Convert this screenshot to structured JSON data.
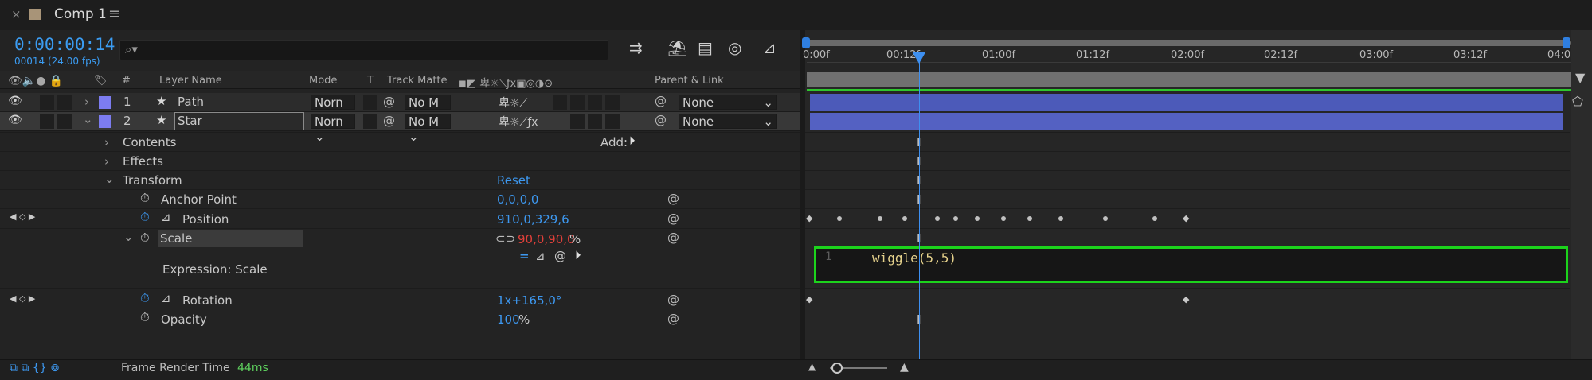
{
  "tab": {
    "close": "×",
    "title": "Comp 1",
    "menu": "≡"
  },
  "timecode": "0:00:00:14",
  "frame_fps": "00014 (24.00 fps)",
  "search": {
    "icon": "⌕▾",
    "placeholder": ""
  },
  "toolbar_icons": [
    "composition-mini-flowchart-icon",
    "draft-3d-icon",
    "frame-blending-icon",
    "motion-blur-icon",
    "graph-editor-icon"
  ],
  "columns": {
    "hash": "#",
    "layer_name": "Layer Name",
    "mode": "Mode",
    "t": "T",
    "track_matte": "Track Matte",
    "parent": "Parent & Link"
  },
  "layers": [
    {
      "num": "1",
      "star": "★",
      "name": "Path",
      "mode": "Norn",
      "matte": "No M",
      "parent": "None",
      "color": "#7c7cf0"
    },
    {
      "num": "2",
      "star": "★",
      "name": "Star",
      "mode": "Norn",
      "matte": "No M",
      "parent": "None",
      "color": "#7c7cf0"
    }
  ],
  "groups": {
    "contents": "Contents",
    "add_label": "Add:",
    "effects": "Effects",
    "transform": "Transform",
    "reset": "Reset"
  },
  "props": {
    "anchor_point": {
      "label": "Anchor Point",
      "value": "0,0,0,0"
    },
    "position": {
      "label": "Position",
      "value": "910,0,329,6"
    },
    "scale": {
      "label": "Scale",
      "value": "90,0,90,0",
      "unit": "%"
    },
    "expression_label": "Expression: Scale",
    "rotation": {
      "label": "Rotation",
      "value": "1x+165,0°"
    },
    "opacity": {
      "label": "Opacity",
      "value": "100",
      "unit": "%"
    }
  },
  "ruler_ticks": [
    "0:00f",
    "00:12f",
    "01:00f",
    "01:12f",
    "02:00f",
    "02:12f",
    "03:00f",
    "03:12f",
    "04:0"
  ],
  "expression": {
    "line_number": "1",
    "code": "wiggle(5,5)"
  },
  "footer": {
    "frame_render_label": "Frame Render Time",
    "frame_render_value": "44ms"
  },
  "colors": {
    "accent": "#3d98f0",
    "label_violet": "#7c7cf0",
    "expr_border": "#1cd31c",
    "value_red": "#e0403a"
  }
}
